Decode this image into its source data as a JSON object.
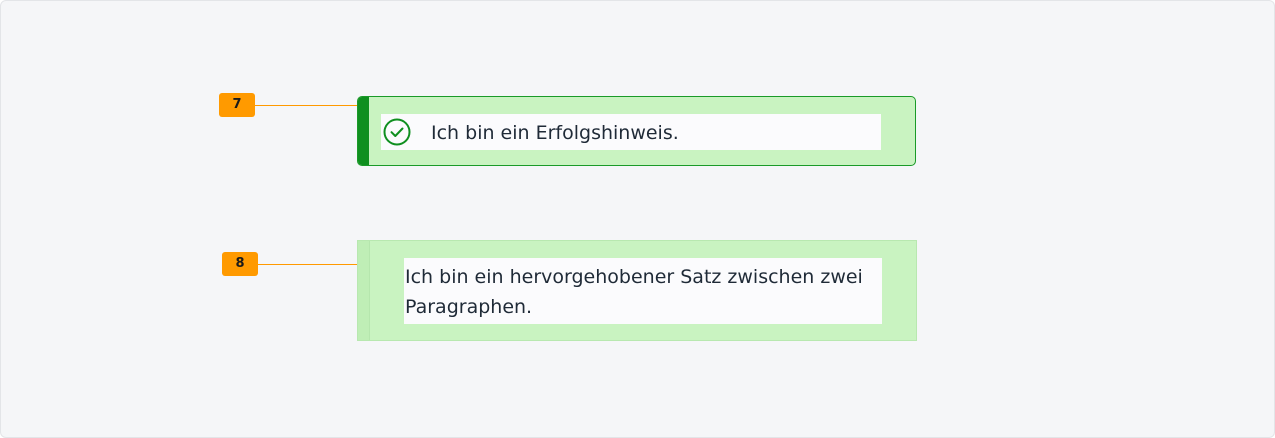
{
  "annotations": [
    {
      "label": "7"
    },
    {
      "label": "8"
    }
  ],
  "success_callout": {
    "text": "Ich bin ein Erfolgshinweis.",
    "icon": "check-circle-icon"
  },
  "highlight_callout": {
    "text": "Ich bin ein hervorgehobener Satz zwischen zwei Paragraphen."
  },
  "colors": {
    "success_border": "#1a9a28",
    "success_accent": "#0f8f1f",
    "callout_background": "#c9f3c1",
    "marker": "#ff9a00"
  }
}
